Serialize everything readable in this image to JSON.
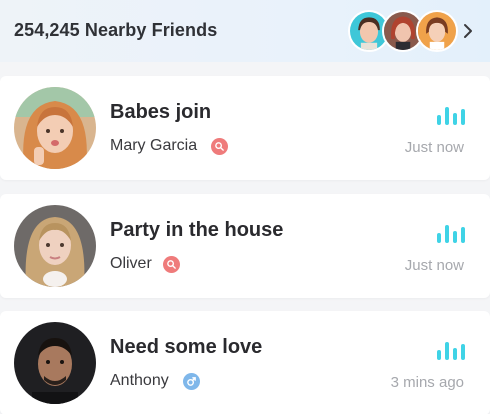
{
  "header": {
    "title": "254,245 Nearby Friends",
    "avatars": [
      {
        "icon": "user-avatar-female-teal"
      },
      {
        "icon": "user-avatar-female-redhead"
      },
      {
        "icon": "user-avatar-female-orange"
      }
    ],
    "more_icon": "chevron-right-icon"
  },
  "rooms": [
    {
      "title": "Babes join",
      "host": "Mary Garcia",
      "gender": "female",
      "time": "Just now"
    },
    {
      "title": "Party in the house",
      "host": "Oliver",
      "gender": "female",
      "time": "Just now"
    },
    {
      "title": "Need some love",
      "host": "Anthony",
      "gender": "male",
      "time": "3 mins ago"
    }
  ],
  "colors": {
    "accent_cyan": "#3fd3e6",
    "female_badge": "#ef7b7b",
    "male_badge": "#7fb7ea",
    "muted_text": "#a6a8ad"
  }
}
